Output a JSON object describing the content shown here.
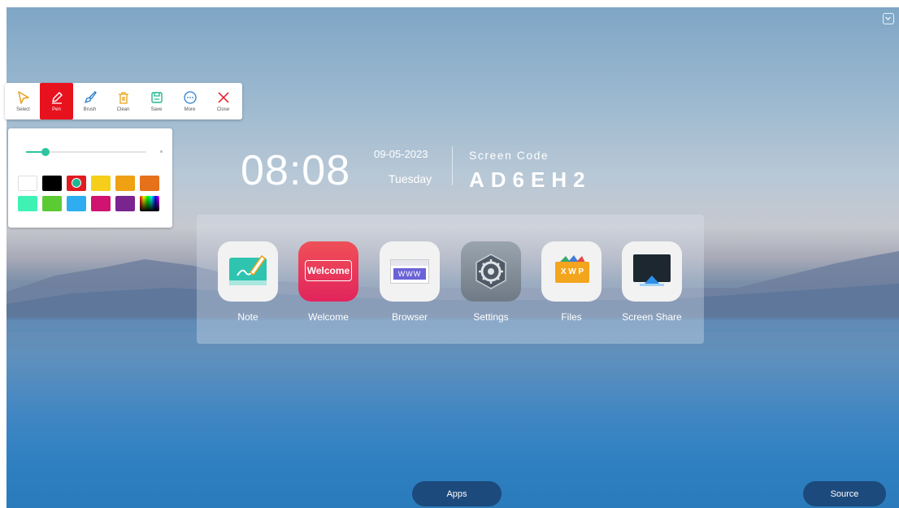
{
  "toolbar": {
    "tools": [
      {
        "label": "Select",
        "icon": "select-cursor-icon"
      },
      {
        "label": "Pen",
        "icon": "pen-icon",
        "active": true
      },
      {
        "label": "Brush",
        "icon": "brush-icon"
      },
      {
        "label": "Clean",
        "icon": "trash-icon"
      },
      {
        "label": "Save",
        "icon": "save-icon"
      },
      {
        "label": "More",
        "icon": "more-icon"
      },
      {
        "label": "Close",
        "icon": "close-icon"
      }
    ]
  },
  "pen_panel": {
    "size_fraction": 0.16,
    "colors": [
      "#ffffff",
      "#000000",
      "#e01b22",
      "#f5cf1a",
      "#eea112",
      "#e5711a",
      "#3ef2b4",
      "#5bcb34",
      "#2eaef0",
      "#d01370",
      "#7a248f",
      "rainbow"
    ],
    "selected_color_index": 2
  },
  "clock": {
    "time": "08:08",
    "date": "09-05-2023",
    "day": "Tuesday",
    "screen_code_label": "Screen Code",
    "screen_code": "AD6EH2"
  },
  "apps": [
    {
      "label": "Note",
      "icon": "note-icon"
    },
    {
      "label": "Welcome",
      "icon": "welcome-icon",
      "icon_text": "Welcome"
    },
    {
      "label": "Browser",
      "icon": "browser-icon",
      "icon_text": "WWW"
    },
    {
      "label": "Settings",
      "icon": "settings-gear-icon"
    },
    {
      "label": "Files",
      "icon": "files-icon",
      "icon_text": "X W P"
    },
    {
      "label": "Screen Share",
      "icon": "screen-share-icon"
    }
  ],
  "bottom": {
    "apps_label": "Apps",
    "source_label": "Source"
  }
}
